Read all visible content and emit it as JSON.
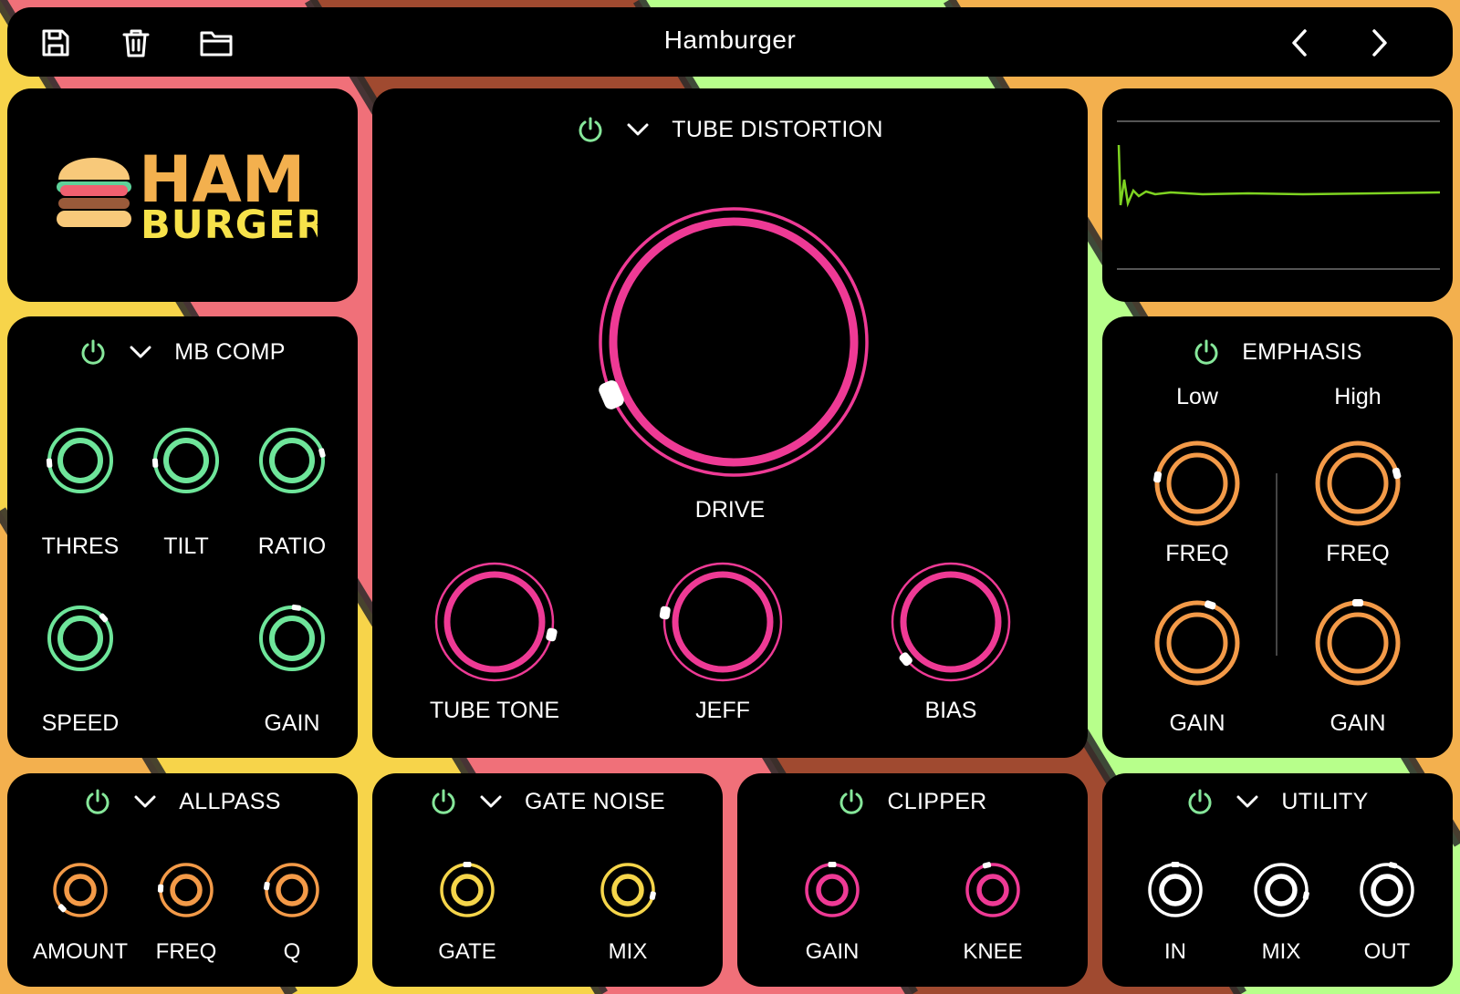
{
  "window": {
    "preset_name": "Hamburger"
  },
  "toolbar": {
    "save_icon": "floppy-disk-icon",
    "delete_icon": "trash-icon",
    "open_icon": "folder-icon",
    "prev_icon": "chevron-left-icon",
    "next_icon": "chevron-right-icon"
  },
  "logo": {
    "line1": "HAM",
    "line2": "BURGER"
  },
  "colors": {
    "background_stripes": [
      "#f3b04e",
      "#f07079",
      "#a04a30",
      "#b7ff8b",
      "#f7d44a"
    ],
    "panel": "#000000",
    "pink": "#ee3a95",
    "green": "#6ee59a",
    "orange": "#f39a48",
    "yellow": "#f5d54a",
    "white": "#ffffff",
    "power_on": "#86e79a",
    "scope_line": "#7ed321"
  },
  "tube_distortion": {
    "title": "TUBE DISTORTION",
    "knobs": {
      "drive": {
        "label": "DRIVE",
        "value": 0.08
      },
      "tube_tone": {
        "label": "TUBE TONE",
        "value": 0.88
      },
      "jeff": {
        "label": "JEFF",
        "value": 0.2
      },
      "bias": {
        "label": "BIAS",
        "value": 0.02
      }
    }
  },
  "mb_comp": {
    "title": "MB COMP",
    "knobs": {
      "thres": {
        "label": "THRES",
        "value": 0.15
      },
      "tilt": {
        "label": "TILT",
        "value": 0.15
      },
      "ratio": {
        "label": "RATIO",
        "value": 0.78
      },
      "speed": {
        "label": "SPEED",
        "value": 0.68
      },
      "gain": {
        "label": "GAIN",
        "value": 0.53
      }
    }
  },
  "emphasis": {
    "title": "EMPHASIS",
    "low_label": "Low",
    "high_label": "High",
    "knobs": {
      "low_freq": {
        "label": "FREQ",
        "value": 0.2
      },
      "high_freq": {
        "label": "FREQ",
        "value": 0.78
      },
      "low_gain": {
        "label": "GAIN",
        "value": 0.57
      },
      "high_gain": {
        "label": "GAIN",
        "value": 0.5
      }
    }
  },
  "allpass": {
    "title": "ALLPASS",
    "knobs": {
      "amount": {
        "label": "AMOUNT",
        "value": 0.0
      },
      "freq": {
        "label": "FREQ",
        "value": 0.18
      },
      "q": {
        "label": "Q",
        "value": 0.2
      }
    }
  },
  "gate_noise": {
    "title": "GATE NOISE",
    "knobs": {
      "gate": {
        "label": "GATE",
        "value": 0.5
      },
      "mix": {
        "label": "MIX",
        "value": 0.88
      }
    }
  },
  "clipper": {
    "title": "CLIPPER",
    "knobs": {
      "gain": {
        "label": "GAIN",
        "value": 0.5
      },
      "knee": {
        "label": "KNEE",
        "value": 0.45
      }
    }
  },
  "utility": {
    "title": "UTILITY",
    "knobs": {
      "in": {
        "label": "IN",
        "value": 0.5
      },
      "mix": {
        "label": "MIX",
        "value": 0.88
      },
      "out": {
        "label": "OUT",
        "value": 0.55
      }
    }
  }
}
